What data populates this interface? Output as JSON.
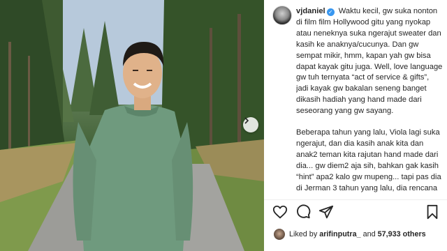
{
  "post": {
    "username": "vjdaniel",
    "verified_icon": "verified-badge-icon",
    "caption_p1": "Waktu kecil, gw suka nonton di film film Hollywood gitu yang nyokap atau neneknya suka ngerajut sweater dan kasih ke anaknya/cucunya. Dan gw sempat mikir, hmm, kapan yah gw bisa dapat kayak gitu juga. Well, love language gw tuh ternyata “act of service & gifts”, jadi kayak gw bakalan seneng banget dikasih hadiah yang hand made dari seseorang yang gw sayang.",
    "caption_p2": "Beberapa tahun yang lalu, Viola lagi suka ngerajut, dan dia kasih anak kita dan anak2 teman kita rajutan hand made dari dia... gw diem2 aja sih, bahkan gak kasih “hint” apa2 kalo gw mupeng... tapi pas dia di Jerman 3 tahun yang lalu, dia rencana mau kasih gw surprise yaitu sweater rajutan.. ternyata sweater yang"
  },
  "likes": {
    "prefix": "Liked by ",
    "user": "arifinputra_",
    "middle": " and ",
    "count": "57,933 others"
  },
  "icons": {
    "like": "heart-icon",
    "comment": "comment-icon",
    "share": "share-icon",
    "save": "bookmark-icon",
    "next": "chevron-right-icon"
  },
  "colors": {
    "text": "#262626",
    "verified": "#3897f0",
    "divider": "#efefef"
  }
}
